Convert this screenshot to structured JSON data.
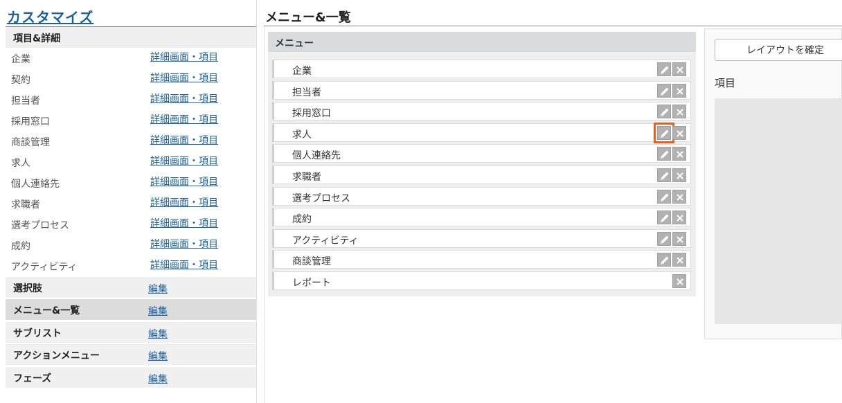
{
  "sidebar": {
    "title": "カスタマイズ",
    "section_items": {
      "label": "項目&詳細"
    },
    "items": [
      {
        "label": "企業",
        "link": "詳細画面・項目"
      },
      {
        "label": "契約",
        "link": "詳細画面・項目"
      },
      {
        "label": "担当者",
        "link": "詳細画面・項目"
      },
      {
        "label": "採用窓口",
        "link": "詳細画面・項目"
      },
      {
        "label": "商談管理",
        "link": "詳細画面・項目"
      },
      {
        "label": "求人",
        "link": "詳細画面・項目"
      },
      {
        "label": "個人連絡先",
        "link": "詳細画面・項目"
      },
      {
        "label": "求職者",
        "link": "詳細画面・項目"
      },
      {
        "label": "選考プロセス",
        "link": "詳細画面・項目"
      },
      {
        "label": "成約",
        "link": "詳細画面・項目"
      },
      {
        "label": "アクティビティ",
        "link": "詳細画面・項目"
      }
    ],
    "sections": [
      {
        "label": "選択肢",
        "link": "編集"
      },
      {
        "label": "メニュー&一覧",
        "link": "編集",
        "active": true
      },
      {
        "label": "サブリスト",
        "link": "編集"
      },
      {
        "label": "アクションメニュー",
        "link": "編集"
      },
      {
        "label": "フェーズ",
        "link": "編集"
      }
    ]
  },
  "main": {
    "title": "メニュー&一覧",
    "menu_header": "メニュー",
    "menu_items": [
      {
        "label": "企業",
        "editable": true
      },
      {
        "label": "担当者",
        "editable": true
      },
      {
        "label": "採用窓口",
        "editable": true
      },
      {
        "label": "求人",
        "editable": true,
        "highlighted": true
      },
      {
        "label": "個人連絡先",
        "editable": true
      },
      {
        "label": "求職者",
        "editable": true
      },
      {
        "label": "選考プロセス",
        "editable": true
      },
      {
        "label": "成約",
        "editable": true
      },
      {
        "label": "アクティビティ",
        "editable": true
      },
      {
        "label": "商談管理",
        "editable": true
      },
      {
        "label": "レポート",
        "editable": false
      }
    ]
  },
  "right": {
    "confirm_label": "レイアウトを確定",
    "items_label": "項目"
  },
  "colors": {
    "link": "#1a5f9e",
    "highlight": "#e8611a",
    "button_gray": "#b2b2b2"
  },
  "icons": {
    "edit": "pencil-icon",
    "delete": "close-icon"
  }
}
